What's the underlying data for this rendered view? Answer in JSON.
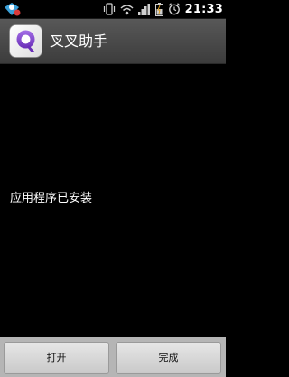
{
  "status_bar": {
    "time": "21:33",
    "icons": [
      "app-notification-icon",
      "vibrate-icon",
      "wifi-icon",
      "signal-icon",
      "battery-charging-icon",
      "alarm-icon"
    ]
  },
  "title_bar": {
    "app_name": "叉叉助手",
    "app_icon": "xx-assistant-logo-icon"
  },
  "content": {
    "message": "应用程序已安装"
  },
  "buttons": {
    "open_label": "打开",
    "done_label": "完成"
  },
  "colors": {
    "background": "#000000",
    "title_bar": "#4a4a4a",
    "button_bar": "#b5b5b5",
    "app_icon_purple": "#7b3fc4"
  }
}
